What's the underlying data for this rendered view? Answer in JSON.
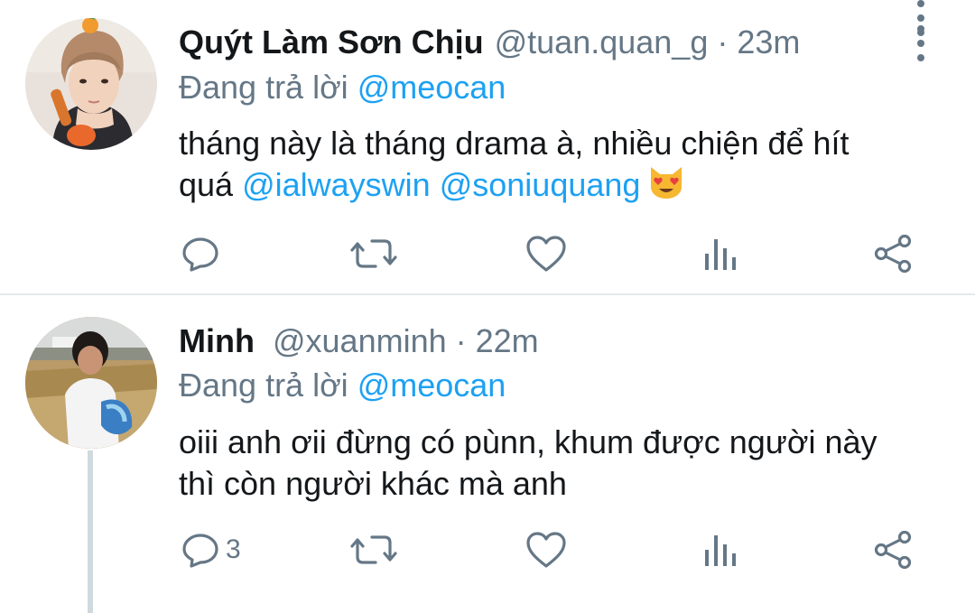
{
  "tweets": [
    {
      "name": "Quýt Làm Sơn Chịu",
      "handle": "@tuan.quan_g",
      "separator": "·",
      "time": "23m",
      "replying_prefix": "Đang trả lời",
      "replying_to": "@meocan",
      "text_line1": "tháng này là tháng drama à, nhiều chiện để hít",
      "text_line2_prefix": "quá",
      "mentions": [
        "@ialwayswin",
        "@soniuquang"
      ],
      "emoji": "smiling-cat-heart-eyes",
      "reply_count": ""
    },
    {
      "name": "Minh",
      "handle": "@xuanminh",
      "separator": "·",
      "time": "22m",
      "replying_prefix": "Đang trả lời",
      "replying_to": "@meocan",
      "text_line1": "oiii anh ơii đừng có pùnn, khum được người này",
      "text_line2": "thì còn người khác mà anh",
      "reply_count": "3"
    }
  ],
  "colors": {
    "accent": "#1da1f2",
    "secondary_text": "#657786",
    "primary_text": "#14171a",
    "icon": "#657786",
    "divider": "#e6e9eb"
  }
}
